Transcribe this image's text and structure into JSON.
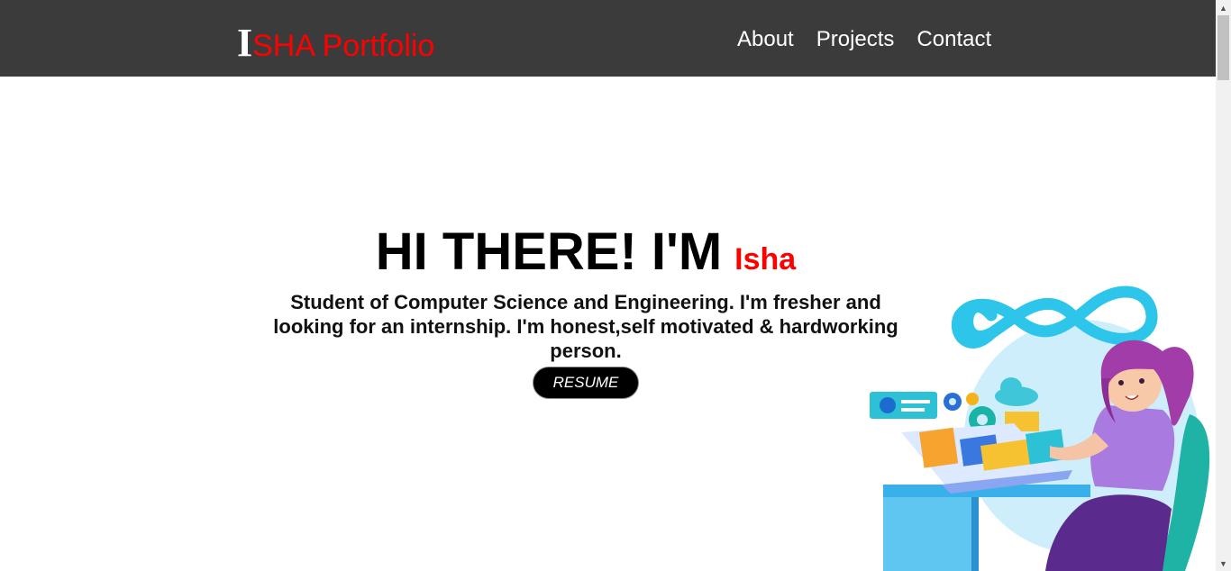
{
  "nav": {
    "brand_initial": "I",
    "brand_rest": "SHA Portfolio",
    "links": [
      "About",
      "Projects",
      "Contact"
    ]
  },
  "hero": {
    "greeting": "HI THERE! I'M",
    "name": "Isha",
    "description": "Student of Computer Science and Engineering. I'm fresher and looking for an internship. I'm honest,self motivated & hardworking person.",
    "button_label": "RESUME"
  },
  "colors": {
    "navbar_bg": "#3b3b3b",
    "accent": "#ff0000",
    "button_bg": "#000000"
  },
  "illustration": {
    "icon": "developer-at-laptop-illustration"
  }
}
